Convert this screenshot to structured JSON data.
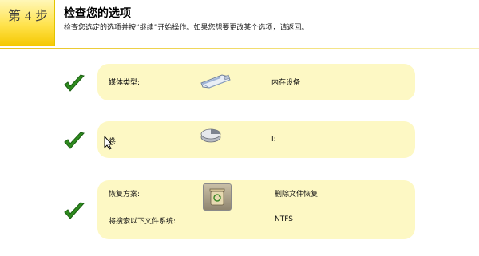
{
  "header": {
    "step_label": "第 4 步",
    "title": "检查您的选项",
    "subtitle": "检查您选定的选项并按“继续”开始操作。如果您想要更改某个选项，请返回。"
  },
  "rows": [
    {
      "label": "媒体类型:",
      "value": "内存设备",
      "icon": "usb-drive-icon"
    },
    {
      "label": "卷:",
      "value": "I:",
      "icon": "disk-volume-icon"
    },
    {
      "label": "恢复方案:",
      "value": "删除文件恢复",
      "icon": "recycle-bin-icon",
      "label2": "将搜索以下文件系统:",
      "value2": "NTFS"
    }
  ],
  "colors": {
    "panel": "#fdf8c4",
    "check": "#2e8b1e",
    "badge": "#ffe24a"
  }
}
